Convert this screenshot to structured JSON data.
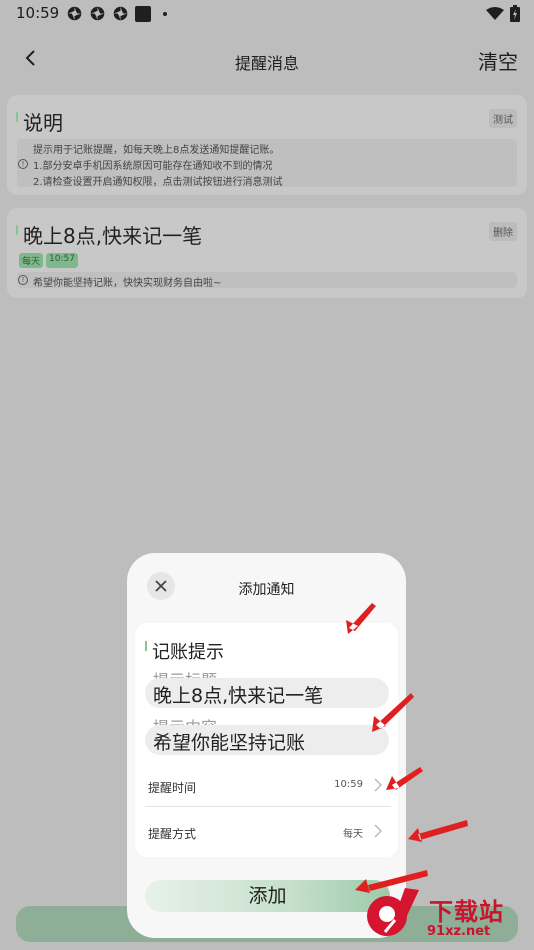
{
  "status_bar": {
    "time": "10:59",
    "icons": [
      "app-icon",
      "app-icon",
      "app-icon",
      "square-icon",
      "dot-icon"
    ],
    "right_icons": [
      "wifi-icon",
      "battery-icon"
    ]
  },
  "header": {
    "title": "提醒消息",
    "clear_label": "清空",
    "back_icon": "back-arrow-icon"
  },
  "cards": [
    {
      "title": "说明",
      "action_label": "测试",
      "lines": [
        "提示用于记账提醒，如每天晚上8点发送通知提醒记账。",
        "1.部分安卓手机因系统原因可能存在通知收不到的情况",
        "2.请检查设置开启通知权限，点击测试按钮进行消息测试"
      ]
    },
    {
      "title": "晚上8点,快来记一笔",
      "action_label": "删除",
      "badges": [
        "每天",
        "10:57"
      ],
      "content": "希望你能坚持记账，快快实现财务自由啦~"
    }
  ],
  "dialog": {
    "title": "添加通知",
    "section_label": "记账提示",
    "title_placeholder": "提示标题",
    "title_value": "晚上8点,快来记一笔",
    "content_placeholder": "提示内容",
    "content_value": "希望你能坚持记账",
    "time_label": "提醒时间",
    "time_value": "10:59",
    "mode_label": "提醒方式",
    "mode_value": "每天",
    "add_label": "添加"
  },
  "watermark": {
    "brand": "下载站",
    "url": "91xz.net",
    "logo_char": "9"
  },
  "colors": {
    "accent_green": "#86c496",
    "arrow_red": "#e02020",
    "watermark_red": "#c8142d"
  }
}
